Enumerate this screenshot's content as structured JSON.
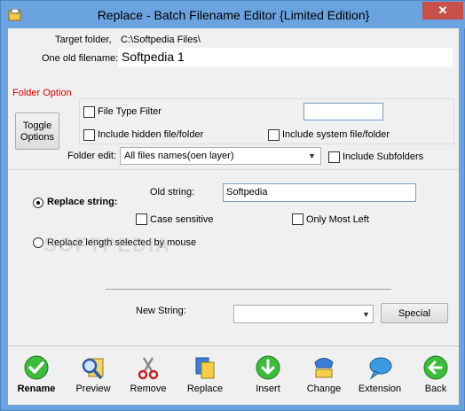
{
  "window": {
    "title": "Replace - Batch Filename Editor {Limited Edition}",
    "close_glyph": "✕",
    "accent_color": "#6aa3df",
    "close_color": "#c7504a"
  },
  "top": {
    "target_folder_label": "Target folder,",
    "target_folder_value": "C:\\Softpedia Files\\",
    "old_filename_label": "One old filename:",
    "old_filename_value": "Softpedia 1"
  },
  "folder_option": {
    "heading": "Folder Option",
    "toggle_label_1": "Toggle",
    "toggle_label_2": "Options",
    "file_type_filter": "File Type Filter",
    "file_type_filter_value": "",
    "include_hidden": "Include hidden file/folder",
    "include_system": "Include system file/folder",
    "folder_edit_label": "Folder edit:",
    "folder_edit_value": "All files names(oen layer)",
    "include_subfolders": "Include Subfolders"
  },
  "replace": {
    "replace_string_label": "Replace string:",
    "replace_string_selected": true,
    "old_string_label": "Old string:",
    "old_string_value": "Softpedia",
    "case_sensitive": "Case sensitive",
    "only_most_left": "Only Most Left",
    "replace_length_label": "Replace length selected by mouse",
    "new_string_label": "New String:",
    "new_string_value": "",
    "special_button": "Special"
  },
  "watermark": "SOFTPEDIA",
  "toolbar": {
    "items": [
      {
        "label": "Rename",
        "icon": "check-icon",
        "bold": true
      },
      {
        "label": "Preview",
        "icon": "magnifier-icon"
      },
      {
        "label": "Remove",
        "icon": "scissors-icon"
      },
      {
        "label": "Replace",
        "icon": "replace-icon"
      },
      {
        "label": "Insert",
        "icon": "down-arrow-icon"
      },
      {
        "label": "Change",
        "icon": "change-icon"
      },
      {
        "label": "Extension",
        "icon": "speech-bubble-icon"
      },
      {
        "label": "Back",
        "icon": "back-arrow-icon"
      }
    ]
  }
}
